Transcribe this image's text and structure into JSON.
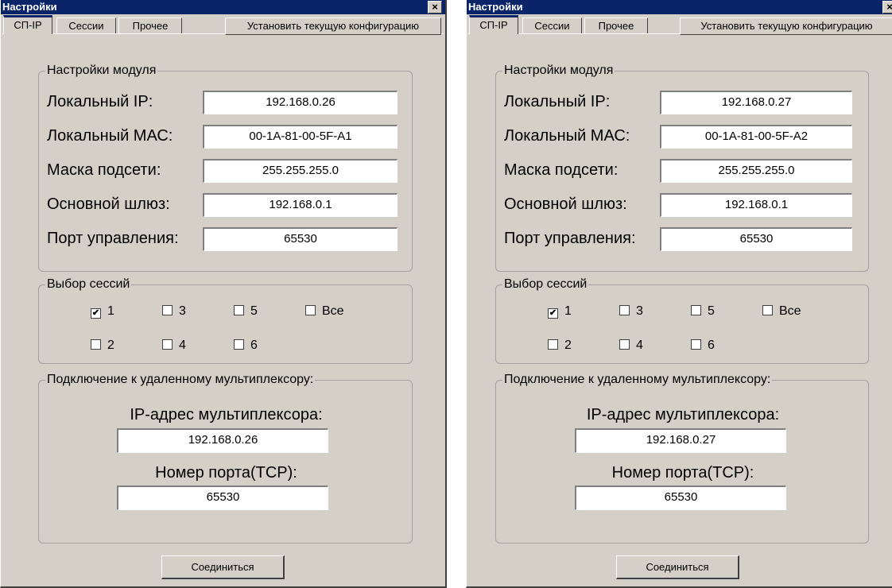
{
  "windows": [
    {
      "title": "Настройки",
      "close_glyph": "×",
      "tabs": [
        "СП-IP",
        "Сессии",
        "Прочее"
      ],
      "apply_label": "Установить текущую конфигурацию",
      "module": {
        "legend": "Настройки модуля",
        "ip_label": "Локальный IP:",
        "ip_value": "192.168.0.26",
        "mac_label": "Локальный МАС:",
        "mac_value": "00-1A-81-00-5F-A1",
        "mask_label": "Маска подсети:",
        "mask_value": "255.255.255.0",
        "gw_label": "Основной шлюз:",
        "gw_value": "192.168.0.1",
        "port_label": "Порт управления:",
        "port_value": "65530"
      },
      "sessions": {
        "legend": "Выбор сессий",
        "items": [
          {
            "label": "1",
            "checked": true
          },
          {
            "label": "3",
            "checked": false
          },
          {
            "label": "5",
            "checked": false
          },
          {
            "label": "Все",
            "checked": false
          },
          {
            "label": "2",
            "checked": false
          },
          {
            "label": "4",
            "checked": false
          },
          {
            "label": "6",
            "checked": false
          }
        ]
      },
      "remote": {
        "legend": "Подключение к удаленному мультиплексору:",
        "ip_label": "IP-адрес мультиплексора:",
        "ip_value": "192.168.0.26",
        "port_label": "Номер порта(TCP):",
        "port_value": "65530"
      },
      "connect_label": "Соединиться"
    },
    {
      "title": "Настройки",
      "close_glyph": "×",
      "tabs": [
        "СП-IP",
        "Сессии",
        "Прочее"
      ],
      "apply_label": "Установить текущую конфигурацию",
      "module": {
        "legend": "Настройки модуля",
        "ip_label": "Локальный IP:",
        "ip_value": "192.168.0.27",
        "mac_label": "Локальный МАС:",
        "mac_value": "00-1A-81-00-5F-A2",
        "mask_label": "Маска подсети:",
        "mask_value": "255.255.255.0",
        "gw_label": "Основной шлюз:",
        "gw_value": "192.168.0.1",
        "port_label": "Порт управления:",
        "port_value": "65530"
      },
      "sessions": {
        "legend": "Выбор сессий",
        "items": [
          {
            "label": "1",
            "checked": true
          },
          {
            "label": "3",
            "checked": false
          },
          {
            "label": "5",
            "checked": false
          },
          {
            "label": "Все",
            "checked": false
          },
          {
            "label": "2",
            "checked": false
          },
          {
            "label": "4",
            "checked": false
          },
          {
            "label": "6",
            "checked": false
          }
        ]
      },
      "remote": {
        "legend": "Подключение к удаленному мультиплексору:",
        "ip_label": "IP-адрес мультиплексора:",
        "ip_value": "192.168.0.27",
        "port_label": "Номер порта(TCP):",
        "port_value": "65530"
      },
      "connect_label": "Соединиться"
    }
  ]
}
